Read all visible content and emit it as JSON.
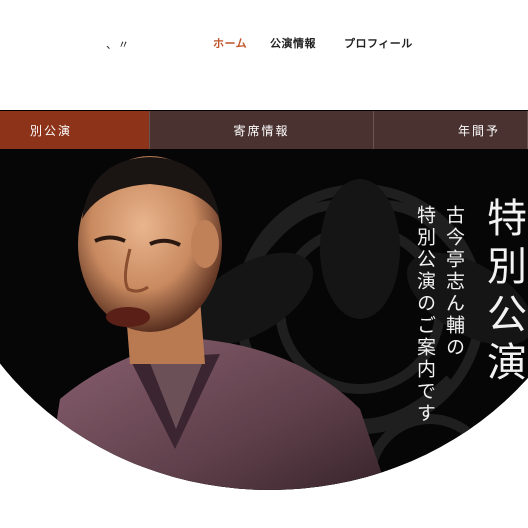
{
  "header": {
    "logo_fragment": "、〃",
    "nav": {
      "home": "ホーム",
      "performance": "公演情報",
      "profile": "プロフィール"
    },
    "active_color": "#c0542a"
  },
  "tabs": [
    {
      "label": "別公演",
      "active": true
    },
    {
      "label": "寄席情報",
      "active": false
    },
    {
      "label": "年間予",
      "active": false
    }
  ],
  "hero": {
    "subtitle_line1": "古今亭志ん輔の",
    "subtitle_line2": "特別公演のご案内です",
    "big_title": "特別公演",
    "image_description": "portrait-performer-icon"
  },
  "colors": {
    "tab_active": "#8c3319",
    "tab_inactive": "#4a3230",
    "hero_bg": "#060606"
  }
}
